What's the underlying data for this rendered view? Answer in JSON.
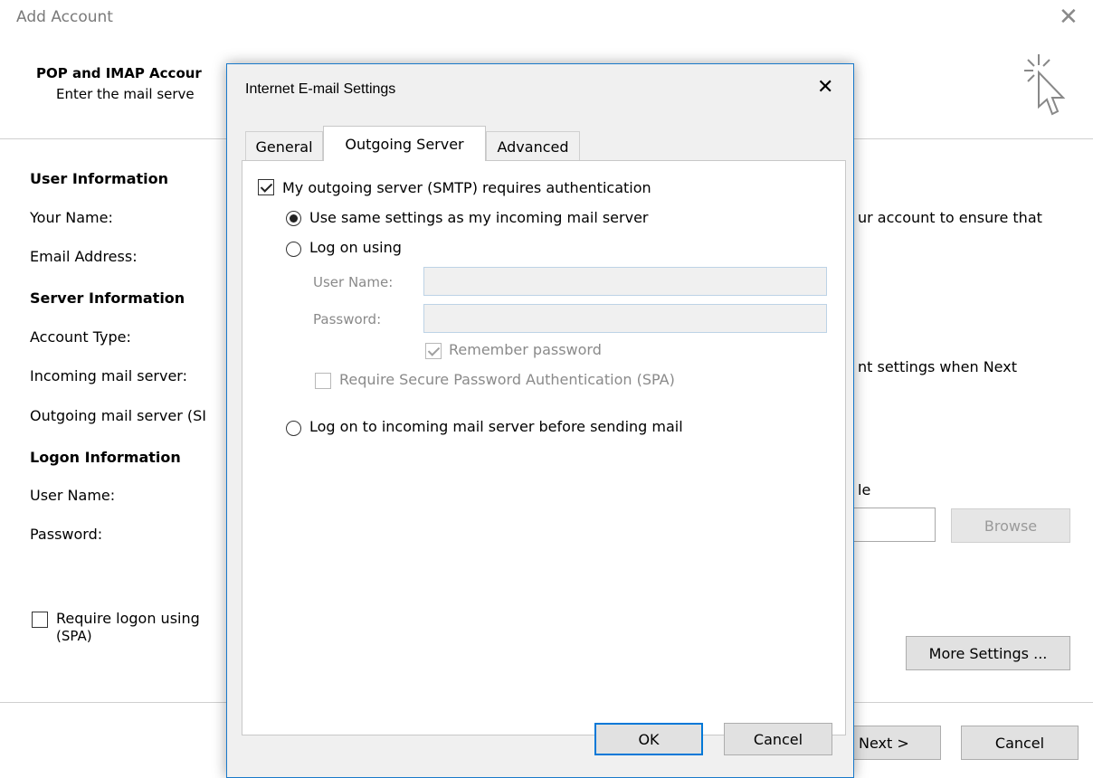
{
  "background_window": {
    "title": "Add Account",
    "close_glyph": "✕",
    "heading": "POP and IMAP Accour",
    "subheading": "Enter the mail serve",
    "user_info_section": "User Information",
    "your_name_label": "Your Name:",
    "email_label": "Email Address:",
    "server_info_section": "Server Information",
    "account_type_label": "Account Type:",
    "incoming_server_label": "Incoming mail server:",
    "outgoing_server_label": "Outgoing mail server (SI",
    "logon_info_section": "Logon Information",
    "username_label": "User Name:",
    "password_label": "Password:",
    "spa_line1": "Require logon using",
    "spa_line2": "(SPA)",
    "right_text_1": "ur account to ensure that",
    "right_text_2": "nt settings when Next",
    "right_text_3": "le",
    "browse_button": "Browse",
    "more_settings_button": "More Settings ...",
    "next_button": "Next >",
    "cancel_button": "Cancel",
    "icon": "cursor-click-icon"
  },
  "dialog": {
    "title": "Internet E-mail Settings",
    "close_glyph": "✕",
    "tabs": [
      {
        "label": "General",
        "active": false
      },
      {
        "label": "Outgoing Server",
        "active": true
      },
      {
        "label": "Advanced",
        "active": false
      }
    ],
    "requires_auth_label": "My outgoing server (SMTP) requires authentication",
    "requires_auth_checked": true,
    "use_same_settings_label": "Use same settings as my incoming mail server",
    "log_on_using_label": "Log on using",
    "username_label": "User Name:",
    "username_value": "",
    "password_label": "Password:",
    "password_value": "",
    "remember_password_label": "Remember password",
    "remember_password_checked": true,
    "require_spa_label": "Require Secure Password Authentication (SPA)",
    "require_spa_checked": false,
    "log_on_incoming_label": "Log on to incoming mail server before sending mail",
    "selected_option": "use_same_settings",
    "ok_button": "OK",
    "cancel_button": "Cancel"
  },
  "colors": {
    "dialog_border": "#1979ca",
    "default_button_border": "#0078d7"
  }
}
